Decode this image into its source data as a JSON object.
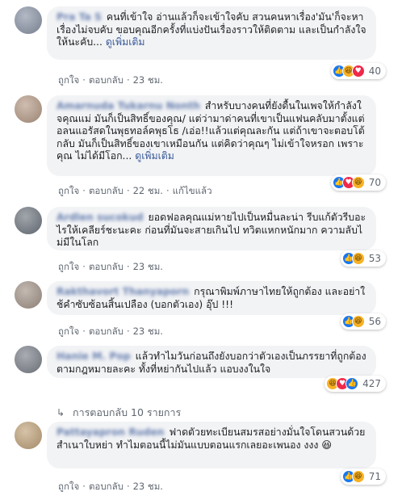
{
  "comments": [
    {
      "name": "Pra Ta S",
      "text": "คนที่เข้าใจ อ่านแล้วก็จะเข้าใจคับ สวนคนหาเรื่อง'มัน'ก็จะหาเรื่องไม่จบคับ ขอบคุณอีกครั้งที่แบ่งปันเรื่องราวให้ติดตาม และเป็นกำลังใจให้นะคับ...",
      "more": "ดูเพิ่มเติม",
      "like": "ถูกใจ",
      "reply": "ตอบกลับ",
      "time": "23 ชม.",
      "edited": "",
      "reactions": [
        "like",
        "haha",
        "love"
      ],
      "count": "40"
    },
    {
      "name": "Amarnuda Tukarnu Nonth",
      "text": "สำหรับบางคนที่ยังดื้นในเพจให้กำลังใจคุณแม่ มันก็เป็นสิทธิ์ของคุณ/ แต่ว่ามาด่าคนที่เขาเป็นแฟนคลับมาตั้งแต่อลนแอรัสดในพุธทอล์คพุธโธ /เอ่อ!!แล้วแต่คุณละกัน แต่ถ้าเขาจะตอบโต้กลับ มันก็เป็นสิทธิ์ของเขาเหมือนกัน แต่คิดว่าคุณๆ ไม่เข้าใจหรอก เพราะคุณ ไม่ได้มีโอก...",
      "more": "ดูเพิ่มเติม",
      "like": "ถูกใจ",
      "reply": "ตอบกลับ",
      "time": "22 ชม.",
      "edited": "แก้ไขแล้ว",
      "reactions": [
        "like",
        "love",
        "haha"
      ],
      "count": "70"
    },
    {
      "name": "Ardlen sucokud",
      "text": "ยอดฟอลคุณแม่หายไปเป็นหมื่นละน่า รีบแก้ตัวรีบอะไรให้เคลียร์ชะนะคะ ก่อนที่มันจะสายเกินไป ทวิตแหกหนักมาก ความลับไม่มีในโลก",
      "more": "",
      "like": "ถูกใจ",
      "reply": "ตอบกลับ",
      "time": "23 ชม.",
      "edited": "",
      "reactions": [
        "like",
        "haha"
      ],
      "count": "53"
    },
    {
      "name": "Rakthavort Thanyaporn",
      "text": "กรุณาพิมพ์ภาษาไทยให้ถูกต้อง และอย่าใช้คำซับซ้อนสิ้นเปลือง (บอกตัวเอง) อุ๊ป !!!",
      "more": "",
      "like": "ถูกใจ",
      "reply": "ตอบกลับ",
      "time": "23 ชม.",
      "edited": "",
      "reactions": [
        "like",
        "haha"
      ],
      "count": "56"
    },
    {
      "name": "Hanie M. Pop",
      "text": "แล้วทำไมวันก่อนถึงยังบอกว่าตัวเองเป็นภรรยาที่ถูกต้องตามกฎหมายละคะ ทั้งที่หย่ากันไปแล้ว แอบงงในใจ",
      "more": "",
      "like": "ถูกใจ",
      "reply": "ตอบกลับ",
      "time": "23 ชม.",
      "edited": "",
      "reactions": [
        "haha",
        "love",
        "like"
      ],
      "count": "427"
    },
    {
      "name": "Pattayapron Ruden",
      "text": "ฟาดตัวยทะเบียนสมรสอย่างมั่นใจโดนสวนด้วยสำเนาใบหย่า ทำไมตอนนี้ไม่มันแบบตอนแรกเลยอะเพนอง งงง 😆",
      "more": "",
      "like": "ถูกใจ",
      "reply": "ตอบกลับ",
      "time": "23 ชม.",
      "edited": "",
      "reactions": [
        "like",
        "haha"
      ],
      "count": "71"
    }
  ],
  "replies_link": "การตอบกลับ 10 รายการ",
  "colors": {
    "link": "#385898",
    "bubble": "#f2f3f5",
    "like": "#1877f2",
    "love": "#f0284a",
    "haha": "#f7b125"
  }
}
